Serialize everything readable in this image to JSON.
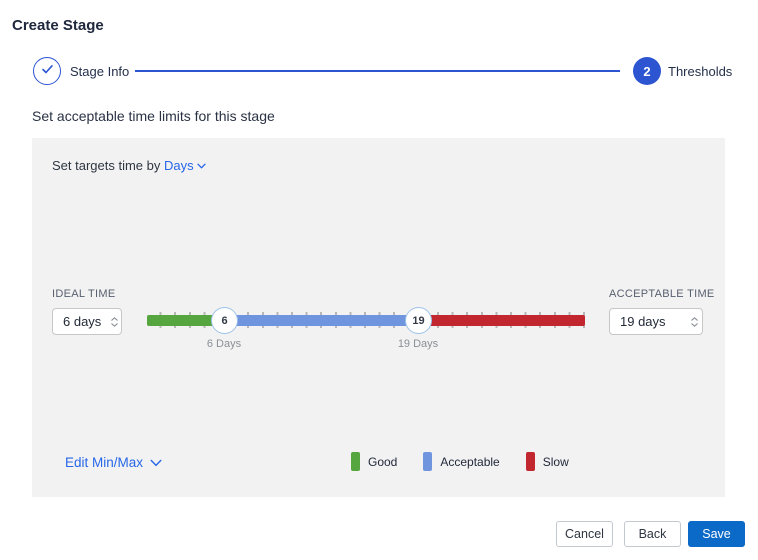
{
  "page": {
    "title": "Create Stage"
  },
  "stepper": {
    "step1": {
      "label": "Stage Info",
      "state": "complete"
    },
    "step2": {
      "label": "Thresholds",
      "number": "2",
      "state": "active"
    }
  },
  "section": {
    "heading": "Set acceptable time limits for this stage"
  },
  "panel": {
    "set_targets_prefix": "Set targets time by",
    "unit_selector_value": "Days",
    "ideal": {
      "label": "IDEAL TIME",
      "value": "6 days"
    },
    "acceptable": {
      "label": "ACCEPTABLE TIME",
      "value": "19 days"
    },
    "slider": {
      "handle_min": {
        "value": "6",
        "caption": "6 Days"
      },
      "handle_max": {
        "value": "19",
        "caption": "19 Days"
      }
    },
    "edit_minmax_label": "Edit Min/Max",
    "legend": {
      "good": {
        "label": "Good",
        "color": "#55A63F"
      },
      "acceptable": {
        "label": "Acceptable",
        "color": "#7095DF"
      },
      "slow": {
        "label": "Slow",
        "color": "#C2262E"
      }
    }
  },
  "footer": {
    "cancel_label": "Cancel",
    "back_label": "Back",
    "save_label": "Save"
  },
  "colors": {
    "accent_blue": "#2D55D2",
    "link_blue": "#2767E8",
    "save_blue": "#0B69C7",
    "panel_bg": "#F2F2F2",
    "good_green": "#55A63F",
    "acceptable_blue": "#7095DF",
    "slow_red": "#C2262E"
  }
}
